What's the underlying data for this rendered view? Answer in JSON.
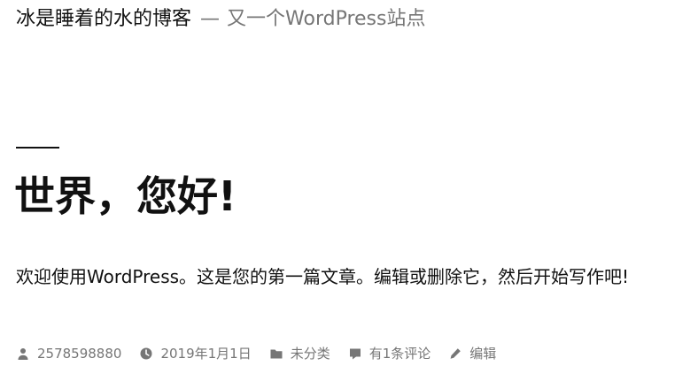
{
  "header": {
    "site_title": "冰是睡着的水的博客",
    "separator": "—",
    "site_description": "又一个WordPress站点"
  },
  "post": {
    "title": "世界，您好!",
    "content": "欢迎使用WordPress。这是您的第一篇文章。编辑或删除它，然后开始写作吧!"
  },
  "footer": {
    "author": "2578598880",
    "date": "2019年1月1日",
    "category": "未分类",
    "comments": "有1条评论",
    "edit": "编辑",
    "icons": {
      "author": "person-icon",
      "date": "clock-icon",
      "category": "folder-icon",
      "comments": "comment-icon",
      "edit": "pencil-icon"
    }
  },
  "colors": {
    "text": "#111111",
    "muted": "#767676",
    "background": "#ffffff"
  }
}
